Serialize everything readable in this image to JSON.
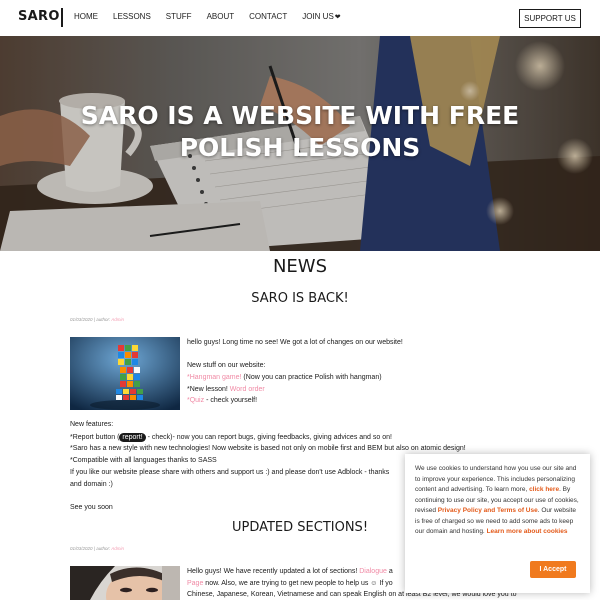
{
  "nav": {
    "logo": "SARO",
    "links": [
      "HOME",
      "LESSONS",
      "STUFF",
      "ABOUT",
      "CONTACT",
      "JOIN US"
    ],
    "support_button": "SUPPORT US",
    "join_icon": "heart-icon"
  },
  "hero": {
    "line1": "SARO IS A WEBSITE WITH FREE",
    "line2": "POLISH LESSONS"
  },
  "news": {
    "title": "NEWS",
    "post1": {
      "title": "SARO IS BACK!",
      "meta_date": "01/03/2020 | author:",
      "meta_author": "Admin",
      "intro": "hello guys! Long time no see! We got a lot of changes on our website!",
      "stuff_heading": "New stuff on our website:",
      "item1_link": "*Hangman game!",
      "item1_rest": " (Now you can practice Polish with hangman)",
      "item2_pre": "*New lesson! ",
      "item2_link": "Word order",
      "item3_link": "*Quiz",
      "item3_rest": " - check yourself!",
      "features_heading": "New features:",
      "feature1_pre": "*Report button (",
      "feature1_badge": "report!",
      "feature1_post": " - check)- now you can report bugs, giving feedbacks, giving advices and so on!",
      "feature2": "*Saro has a new style with new technologies! Now website is based not only on mobile first and BEM but also on atomic design!",
      "feature3": "*Compatible with all languages thanks to SASS",
      "support_line": "If you like our website please share with others and support us :) and please don't use Adblock - thanks",
      "support_line2": "and domain :)",
      "sign_off": "See you soon"
    },
    "post2": {
      "title": "UPDATED SECTIONS!",
      "meta_date": "01/03/2020 | author:",
      "meta_author": "Admin",
      "line1_pre": "Hello guys! We have recently updated a lot of sections! ",
      "line1_link": "Dialogue",
      "line1_post": " a",
      "line2_link": "Page",
      "line2_post": " now. Also, we are trying to get new people to help us ☺ If yo",
      "line3": "Chinese, Japanese, Korean, Vietnamese and can speak English on at least B2 level, we would love you to"
    }
  },
  "cookie": {
    "t1": "We use cookies to understand how you use our site and to improve your experience. This includes personalizing content and advertising. To learn more, ",
    "click_here": "click here",
    "t2": ". By continuing to use our site, you accept our use of cookies, revised ",
    "privacy": "Privacy Policy and Terms of Use",
    "t3": ". Our website is free of charged so we need to add some ads to keep our domain and hosting. ",
    "learn_more": "Learn more about cookies",
    "accept": "I Accept"
  },
  "colors": {
    "accent_pink": "#f08aa5",
    "accept_orange": "#f07a1e",
    "cookie_link": "#e35a1a"
  }
}
